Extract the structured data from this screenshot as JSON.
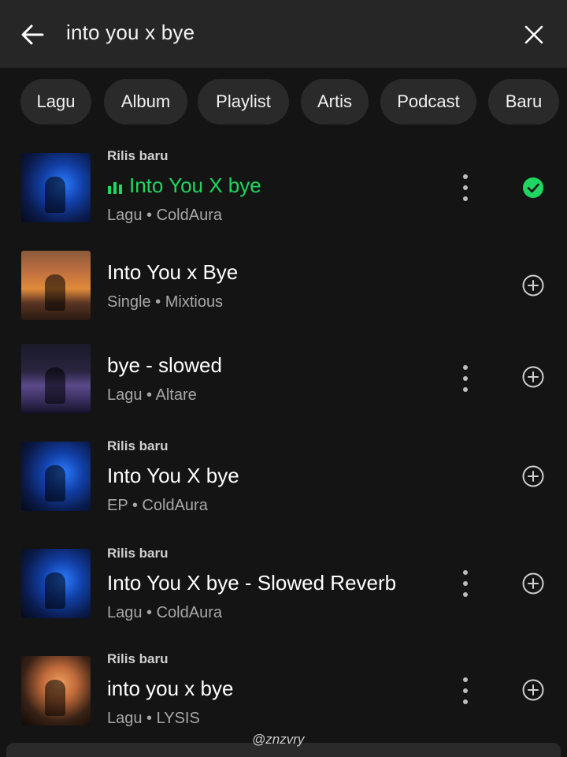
{
  "search": {
    "query": "into you x bye"
  },
  "filters": [
    "Lagu",
    "Album",
    "Playlist",
    "Artis",
    "Podcast",
    "Baru"
  ],
  "results": [
    {
      "tag": "Rilis baru",
      "title": "Into You X bye",
      "subtitle": "Lagu • ColdAura",
      "thumb": "blue",
      "playing": true,
      "more": true,
      "action": "added-check-icon"
    },
    {
      "tag": "",
      "title": "Into You x Bye",
      "subtitle": "Single • Mixtious",
      "thumb": "sunset",
      "playing": false,
      "more": false,
      "action": "add-icon"
    },
    {
      "tag": "",
      "title": "bye - slowed",
      "subtitle": "Lagu • Altare",
      "thumb": "purple",
      "playing": false,
      "more": true,
      "action": "add-icon"
    },
    {
      "tag": "Rilis baru",
      "title": "Into You X bye",
      "subtitle": "EP • ColdAura",
      "thumb": "blue",
      "playing": false,
      "more": false,
      "action": "add-icon"
    },
    {
      "tag": "Rilis baru",
      "title": "Into You X bye - Slowed Reverb",
      "subtitle": "Lagu • ColdAura",
      "thumb": "blue",
      "playing": false,
      "more": true,
      "action": "add-icon"
    },
    {
      "tag": "Rilis baru",
      "title": "into you x bye",
      "subtitle": "Lagu • LYSIS",
      "thumb": "warm",
      "playing": false,
      "more": true,
      "action": "add-icon"
    }
  ],
  "watermark": "@znzvry",
  "colors": {
    "accent": "#1ed760",
    "background": "#141414",
    "chip": "#2a2a2a"
  }
}
